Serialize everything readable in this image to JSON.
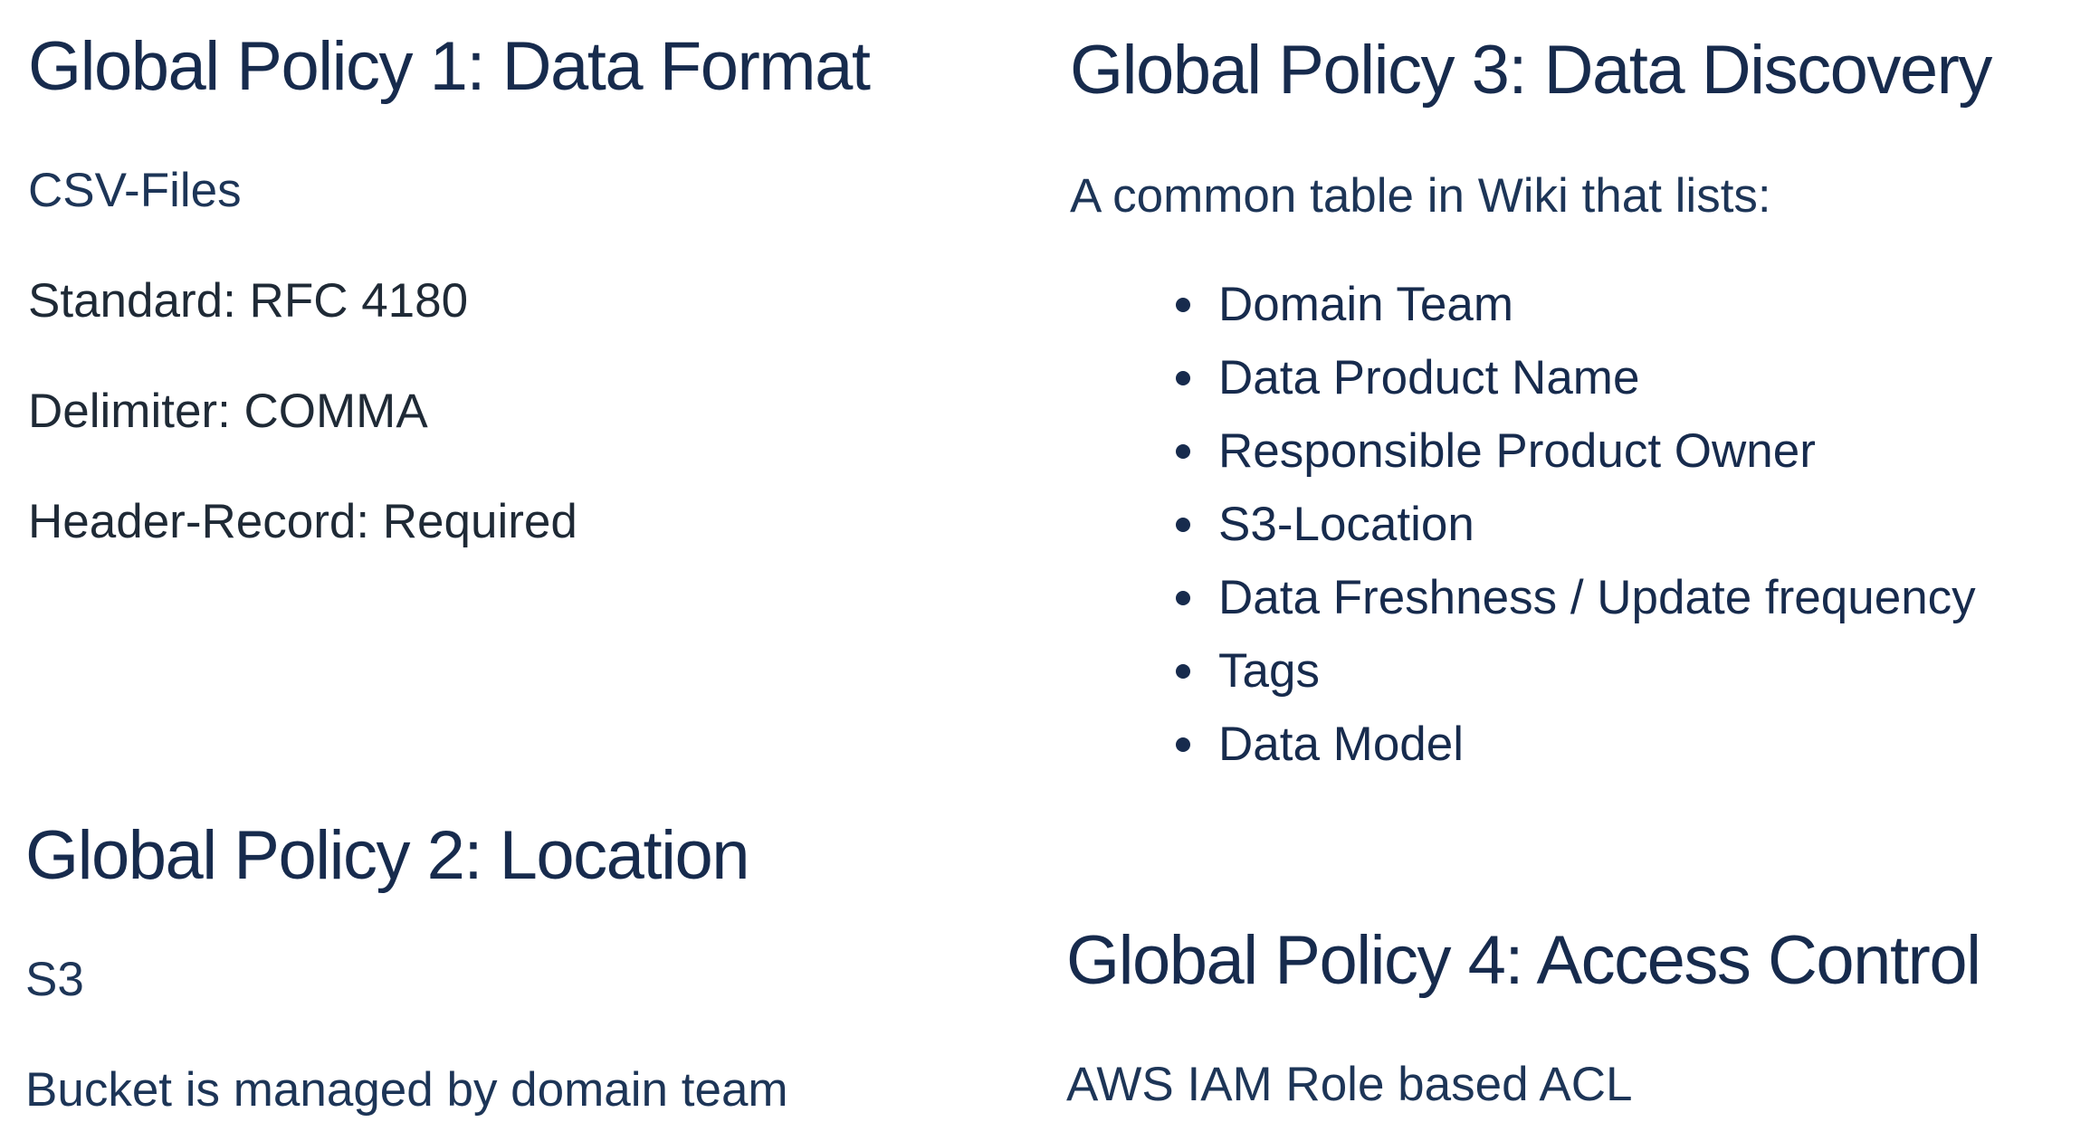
{
  "policy1": {
    "title": "Global Policy 1: Data Format",
    "lines": [
      "CSV-Files",
      "Standard: RFC 4180",
      "Delimiter: COMMA",
      "Header-Record: Required"
    ]
  },
  "policy2": {
    "title": "Global Policy 2: Location",
    "lines": [
      "S3",
      "Bucket is managed by domain team"
    ]
  },
  "policy3": {
    "title": "Global Policy 3: Data Discovery",
    "intro": "A common table in Wiki that lists:",
    "items": [
      "Domain Team",
      "Data Product Name",
      "Responsible Product Owner",
      "S3-Location",
      "Data Freshness / Update frequency",
      "Tags",
      "Data Model"
    ]
  },
  "policy4": {
    "title": "Global Policy 4: Access Control",
    "lines": [
      "AWS IAM Role based ACL"
    ]
  }
}
